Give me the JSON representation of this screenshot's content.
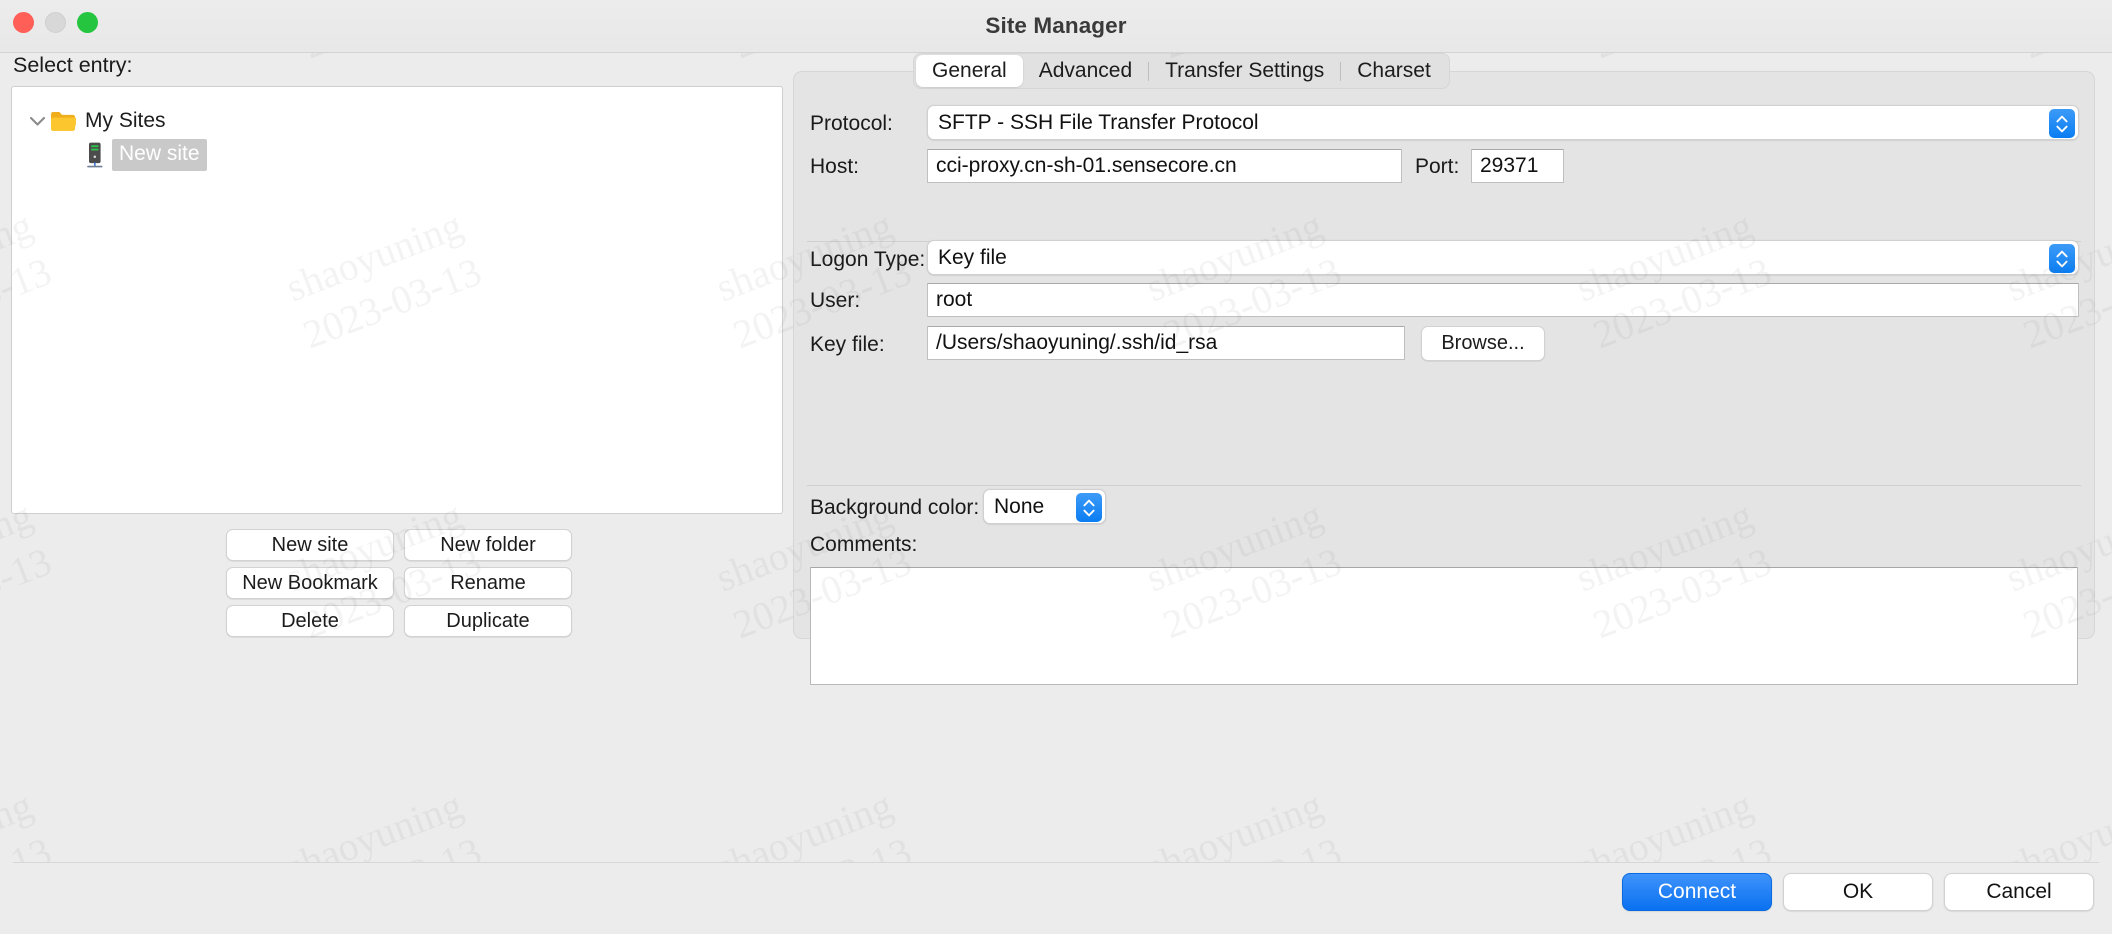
{
  "window": {
    "title": "Site Manager",
    "traffic_lights": [
      "close-button",
      "minimize-button",
      "zoom-button"
    ]
  },
  "watermark": {
    "line1": "shaoyuning",
    "line2": "2023-03-13"
  },
  "left": {
    "select_entry_label": "Select entry:",
    "tree": {
      "root": {
        "label": "My Sites",
        "icon": "folder-icon",
        "expanded": true
      },
      "children": [
        {
          "label": "New site",
          "icon": "server-icon",
          "selected": true
        }
      ]
    },
    "buttons": [
      {
        "label": "New site",
        "name": "new-site-button"
      },
      {
        "label": "New folder",
        "name": "new-folder-button"
      },
      {
        "label": "New Bookmark",
        "name": "new-bookmark-button"
      },
      {
        "label": "Rename",
        "name": "rename-button"
      },
      {
        "label": "Delete",
        "name": "delete-button"
      },
      {
        "label": "Duplicate",
        "name": "duplicate-button"
      }
    ]
  },
  "right": {
    "tabs": [
      {
        "label": "General",
        "active": true
      },
      {
        "label": "Advanced",
        "active": false
      },
      {
        "label": "Transfer Settings",
        "active": false
      },
      {
        "label": "Charset",
        "active": false
      }
    ],
    "fields": {
      "protocol_label": "Protocol:",
      "protocol_value": "SFTP - SSH File Transfer Protocol",
      "host_label": "Host:",
      "host_value": "cci-proxy.cn-sh-01.sensecore.cn",
      "port_label": "Port:",
      "port_value": "29371",
      "logon_type_label": "Logon Type:",
      "logon_type_value": "Key file",
      "user_label": "User:",
      "user_value": "root",
      "key_file_label": "Key file:",
      "key_file_value": "/Users/shaoyuning/.ssh/id_rsa",
      "browse_label": "Browse...",
      "background_color_label": "Background color:",
      "background_color_value": "None",
      "comments_label": "Comments:",
      "comments_value": ""
    }
  },
  "footer": {
    "connect_label": "Connect",
    "ok_label": "OK",
    "cancel_label": "Cancel"
  },
  "colors": {
    "accent": "#0a7df2",
    "folder": "#f5b919",
    "selection": "#c9c9c9"
  }
}
